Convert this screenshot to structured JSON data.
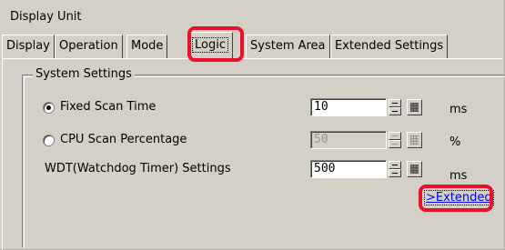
{
  "window": {
    "title": "Display Unit"
  },
  "tabs": [
    {
      "label": "Display"
    },
    {
      "label": "Operation"
    },
    {
      "label": "Mode"
    },
    {
      "label": "Logic"
    },
    {
      "label": "System Area"
    },
    {
      "label": "Extended Settings"
    }
  ],
  "active_tab": "Logic",
  "system_settings": {
    "legend": "System Settings",
    "fixed_scan": {
      "label": "Fixed Scan Time",
      "selected": true,
      "value": "10",
      "unit": "ms"
    },
    "cpu_scan": {
      "label": "CPU Scan Percentage",
      "selected": false,
      "value": "50",
      "unit": "%"
    },
    "wdt": {
      "label": "WDT(Watchdog Timer) Settings",
      "value": "500",
      "unit": "ms"
    },
    "extended_link": ">Extended"
  },
  "colors": {
    "highlight": "#e8102a",
    "panel": "#d4d0c8",
    "link": "#0000ee"
  },
  "icons": [
    "calculator-icon",
    "spin-up-icon",
    "spin-down-icon"
  ]
}
